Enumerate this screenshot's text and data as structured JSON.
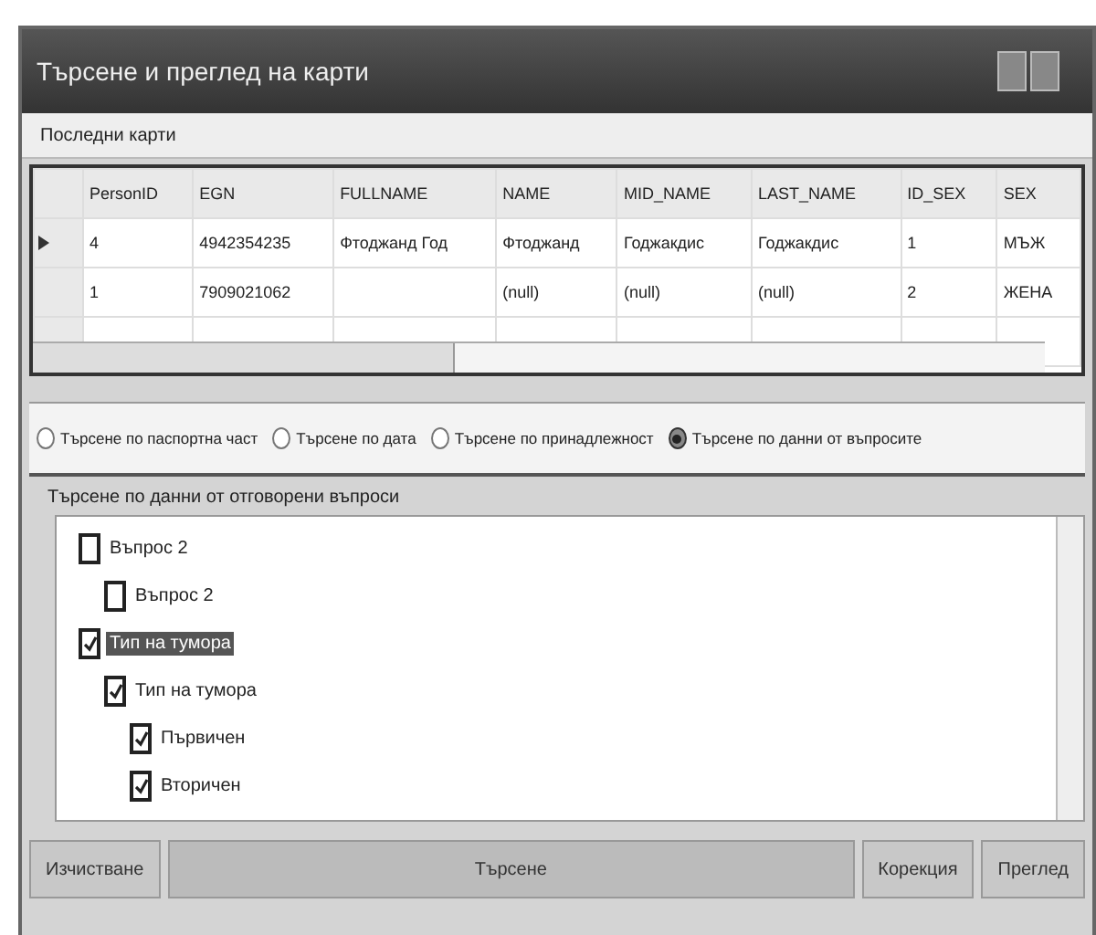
{
  "window": {
    "title": "Търсене и преглед на карти"
  },
  "menu": [
    "Последни карти"
  ],
  "grid": {
    "columns": [
      "PersonID",
      "EGN",
      "FULLNAME",
      "NAME",
      "MID_NAME",
      "LAST_NAME",
      "ID_SEX",
      "SEX"
    ],
    "rows": [
      {
        "current": true,
        "cells": [
          "4",
          "4942354235",
          "Фтоджанд Год",
          "Фтоджанд",
          "Годжакдис",
          "Годжакдис",
          "1",
          "МЪЖ"
        ]
      },
      {
        "current": false,
        "cells": [
          "1",
          "7909021062",
          "",
          "(null)",
          "(null)",
          "(null)",
          "2",
          "ЖЕНА"
        ]
      }
    ]
  },
  "search_modes": [
    {
      "label": "Търсене по паспортна част",
      "selected": false
    },
    {
      "label": "Търсене по дата",
      "selected": false
    },
    {
      "label": "Търсене по принадлежност",
      "selected": false
    },
    {
      "label": "Търсене по данни от въпросите",
      "selected": true
    }
  ],
  "question_group": {
    "title": "Търсене по данни от отговорени въпроси",
    "tree": [
      {
        "label": "Въпрос 2",
        "checked": false,
        "selected": false,
        "children": [
          {
            "label": "Въпрос 2",
            "checked": false,
            "selected": false
          }
        ]
      },
      {
        "label": "Тип на тумора",
        "checked": true,
        "selected": true,
        "children": [
          {
            "label": "Тип на тумора",
            "checked": true,
            "selected": false,
            "children": [
              {
                "label": "Първичен",
                "checked": true,
                "selected": false
              },
              {
                "label": "Вторичен",
                "checked": true,
                "selected": false
              }
            ]
          }
        ]
      }
    ]
  },
  "buttons": [
    "Изчистване",
    "Търсене",
    "Корекция",
    "Преглед"
  ]
}
